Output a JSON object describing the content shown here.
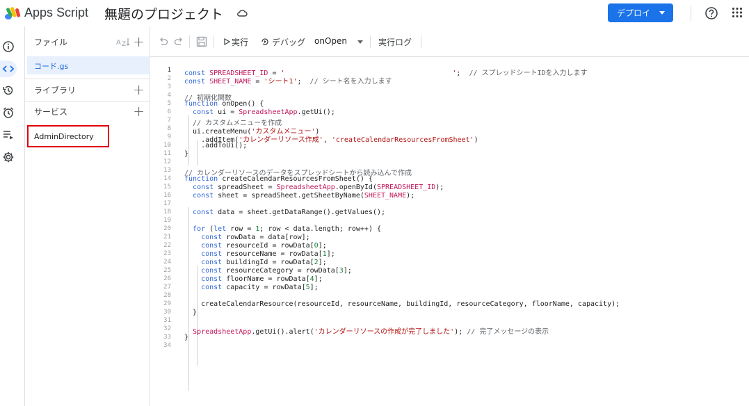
{
  "header": {
    "app_name": "Apps Script",
    "project_name": "無題のプロジェクト",
    "deploy_label": "デプロイ"
  },
  "files_panel": {
    "files_label": "ファイル",
    "file_name": "コード.gs",
    "libraries_label": "ライブラリ",
    "services_label": "サービス",
    "service_item": "AdminDirectory"
  },
  "toolbar": {
    "run_label": "実行",
    "debug_label": "デバッグ",
    "function_select": "onOpen",
    "log_label": "実行ログ"
  },
  "code_lines": [
    {
      "n": "1",
      "text": "const SPREADSHEET_ID = '                                        ';  // スプレッドシートIDを入力します"
    },
    {
      "n": "2",
      "text": "const SHEET_NAME = 'シート1';  // シート名を入力します"
    },
    {
      "n": "3",
      "text": ""
    },
    {
      "n": "4",
      "text": "// 初期化関数"
    },
    {
      "n": "5",
      "text": "function onOpen() {"
    },
    {
      "n": "6",
      "text": "  const ui = SpreadsheetApp.getUi();"
    },
    {
      "n": "7",
      "text": "  // カスタムメニューを作成"
    },
    {
      "n": "8",
      "text": "  ui.createMenu('カスタムメニュー')"
    },
    {
      "n": "9",
      "text": "    .addItem('カレンダーリソース作成', 'createCalendarResourcesFromSheet')"
    },
    {
      "n": "10",
      "text": "    .addToUi();"
    },
    {
      "n": "11",
      "text": "}"
    },
    {
      "n": "12",
      "text": ""
    },
    {
      "n": "13",
      "text": "// カレンダーリソースのデータをスプレッドシートから読み込んで作成"
    },
    {
      "n": "14",
      "text": "function createCalendarResourcesFromSheet() {"
    },
    {
      "n": "15",
      "text": "  const spreadSheet = SpreadsheetApp.openById(SPREADSHEET_ID);"
    },
    {
      "n": "16",
      "text": "  const sheet = spreadSheet.getSheetByName(SHEET_NAME);"
    },
    {
      "n": "17",
      "text": ""
    },
    {
      "n": "18",
      "text": "  const data = sheet.getDataRange().getValues();"
    },
    {
      "n": "19",
      "text": ""
    },
    {
      "n": "20",
      "text": "  for (let row = 1; row < data.length; row++) {"
    },
    {
      "n": "21",
      "text": "    const rowData = data[row];"
    },
    {
      "n": "22",
      "text": "    const resourceId = rowData[0];"
    },
    {
      "n": "23",
      "text": "    const resourceName = rowData[1];"
    },
    {
      "n": "24",
      "text": "    const buildingId = rowData[2];"
    },
    {
      "n": "25",
      "text": "    const resourceCategory = rowData[3];"
    },
    {
      "n": "26",
      "text": "    const floorName = rowData[4];"
    },
    {
      "n": "27",
      "text": "    const capacity = rowData[5];"
    },
    {
      "n": "28",
      "text": ""
    },
    {
      "n": "29",
      "text": "    createCalendarResource(resourceId, resourceName, buildingId, resourceCategory, floorName, capacity);"
    },
    {
      "n": "30",
      "text": "  }"
    },
    {
      "n": "31",
      "text": ""
    },
    {
      "n": "32",
      "text": "  SpreadsheetApp.getUi().alert('カレンダーリソースの作成が完了しました'); // 完了メッセージの表示"
    },
    {
      "n": "33",
      "text": "}"
    },
    {
      "n": "34",
      "text": ""
    }
  ],
  "colors": {
    "accent": "#1a73e8",
    "highlight_border": "#e00000",
    "active_file_bg": "#e8f0fe"
  }
}
